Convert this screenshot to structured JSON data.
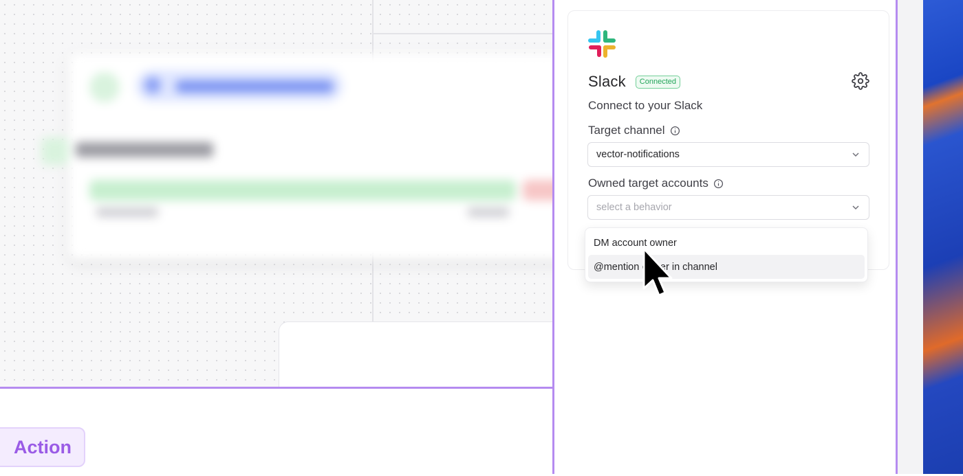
{
  "bottom_panel": {
    "action_label": "Action"
  },
  "slack_card": {
    "title": "Slack",
    "status": "Connected",
    "subtitle": "Connect to your Slack",
    "target_channel": {
      "label": "Target channel",
      "value": "vector-notifications"
    },
    "owned_accounts": {
      "label": "Owned target accounts",
      "placeholder": "select a behavior"
    }
  },
  "dropdown": {
    "options": [
      "DM account owner",
      "@mention owner in channel"
    ]
  },
  "icons": {
    "settings": "gear-icon",
    "info": "info-icon",
    "chevron": "chevron-down-icon",
    "logo": "slack-logo-icon",
    "cursor": "mouse-pointer-icon"
  },
  "colors": {
    "accent_purple": "#b58bf0",
    "action_text": "#9a5be6",
    "connected_green": "#23a55a"
  }
}
